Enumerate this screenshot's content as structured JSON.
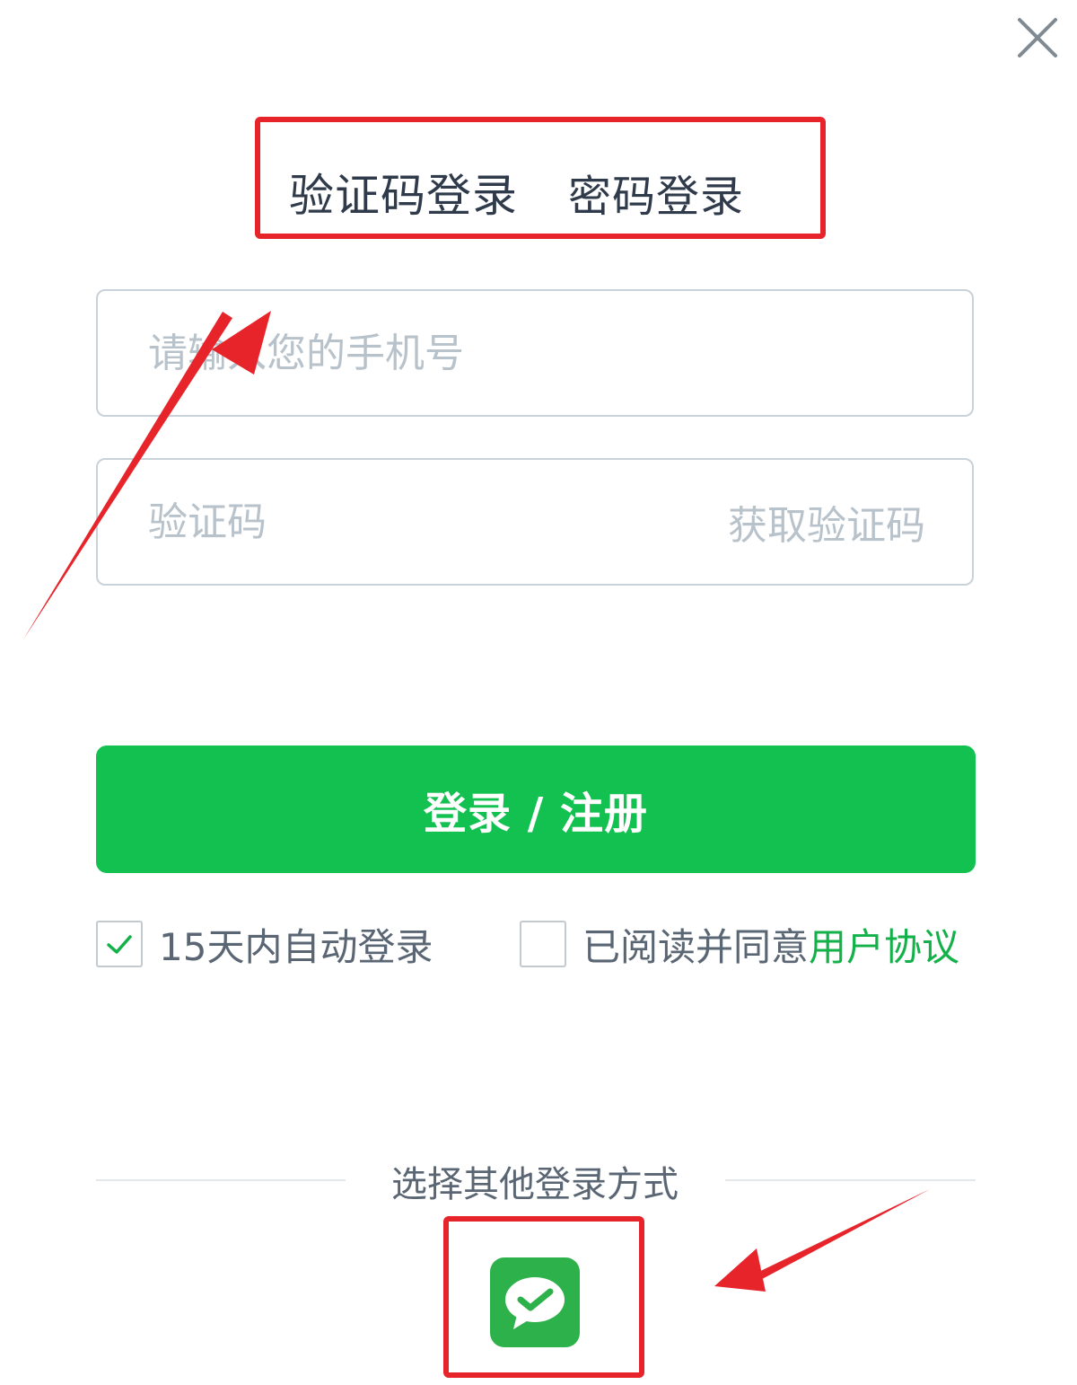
{
  "dialog": {
    "tabs": [
      {
        "label": "验证码登录"
      },
      {
        "label": "密码登录"
      }
    ],
    "phone_field": {
      "placeholder": "请输入您的手机号",
      "value": ""
    },
    "code_field": {
      "placeholder": "验证码",
      "value": "",
      "get_code_label": "获取验证码"
    },
    "login_button_label": "登录 / 注册",
    "auto_login": {
      "label": "15天内自动登录",
      "checked": true
    },
    "agreement": {
      "label": "已阅读并同意",
      "link_label": "用户协议",
      "checked": false
    },
    "other_methods_title": "选择其他登录方式",
    "other_methods": [
      {
        "icon": "wechat-icon"
      }
    ]
  },
  "annotations": {
    "highlight_color": "#e8242b"
  },
  "colors": {
    "accent_green": "#13c151",
    "link_green": "#13b14a",
    "wechat_green": "#2db14a"
  }
}
